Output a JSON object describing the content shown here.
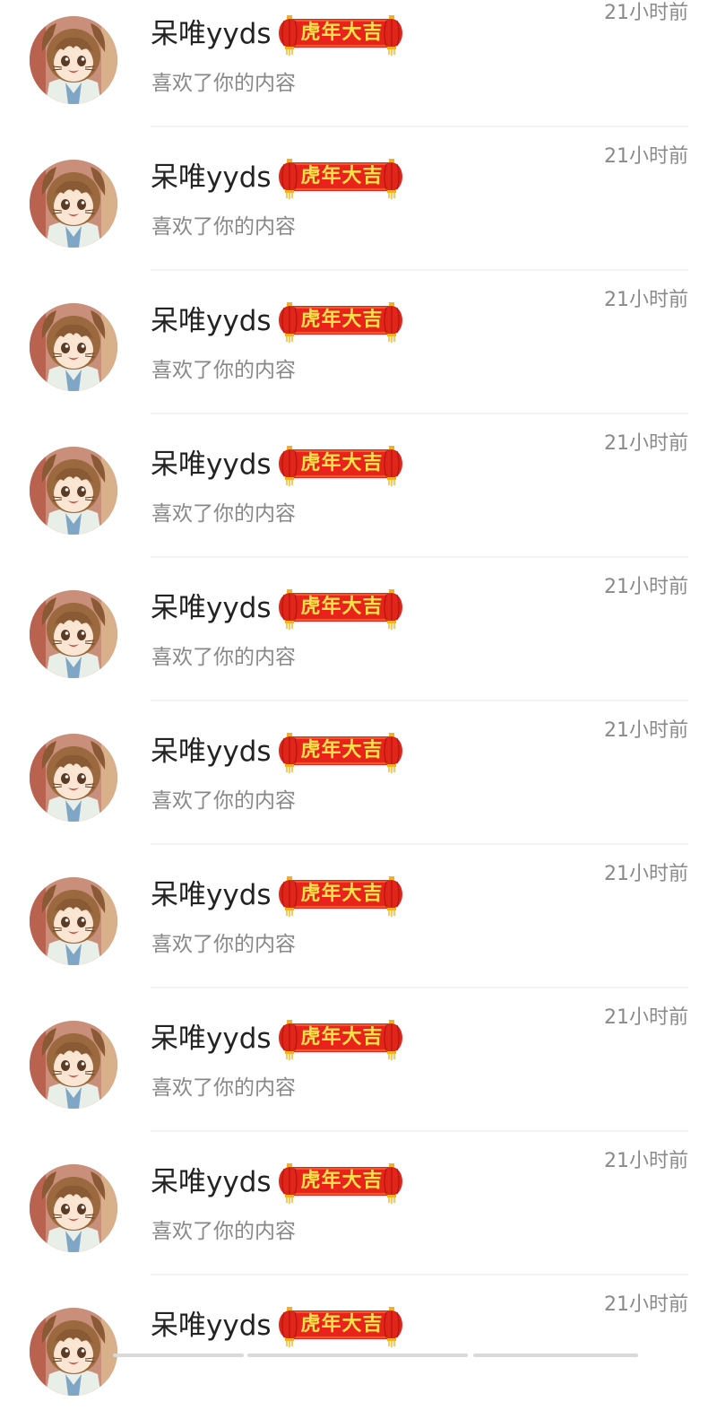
{
  "notifications": [
    {
      "username": "呆唯yyds",
      "badge": "虎年大吉",
      "action": "喜欢了你的内容",
      "time": "21小时前"
    },
    {
      "username": "呆唯yyds",
      "badge": "虎年大吉",
      "action": "喜欢了你的内容",
      "time": "21小时前"
    },
    {
      "username": "呆唯yyds",
      "badge": "虎年大吉",
      "action": "喜欢了你的内容",
      "time": "21小时前"
    },
    {
      "username": "呆唯yyds",
      "badge": "虎年大吉",
      "action": "喜欢了你的内容",
      "time": "21小时前"
    },
    {
      "username": "呆唯yyds",
      "badge": "虎年大吉",
      "action": "喜欢了你的内容",
      "time": "21小时前"
    },
    {
      "username": "呆唯yyds",
      "badge": "虎年大吉",
      "action": "喜欢了你的内容",
      "time": "21小时前"
    },
    {
      "username": "呆唯yyds",
      "badge": "虎年大吉",
      "action": "喜欢了你的内容",
      "time": "21小时前"
    },
    {
      "username": "呆唯yyds",
      "badge": "虎年大吉",
      "action": "喜欢了你的内容",
      "time": "21小时前"
    },
    {
      "username": "呆唯yyds",
      "badge": "虎年大吉",
      "action": "喜欢了你的内容",
      "time": "21小时前"
    },
    {
      "username": "呆唯yyds",
      "badge": "虎年大吉",
      "action": "",
      "time": "21小时前"
    }
  ],
  "colors": {
    "badge_red": "#e8231c",
    "badge_text": "#ffe24a",
    "lantern_red": "#e0261a",
    "lantern_gold": "#f2b01e",
    "username": "#222222",
    "secondary": "#888888"
  }
}
